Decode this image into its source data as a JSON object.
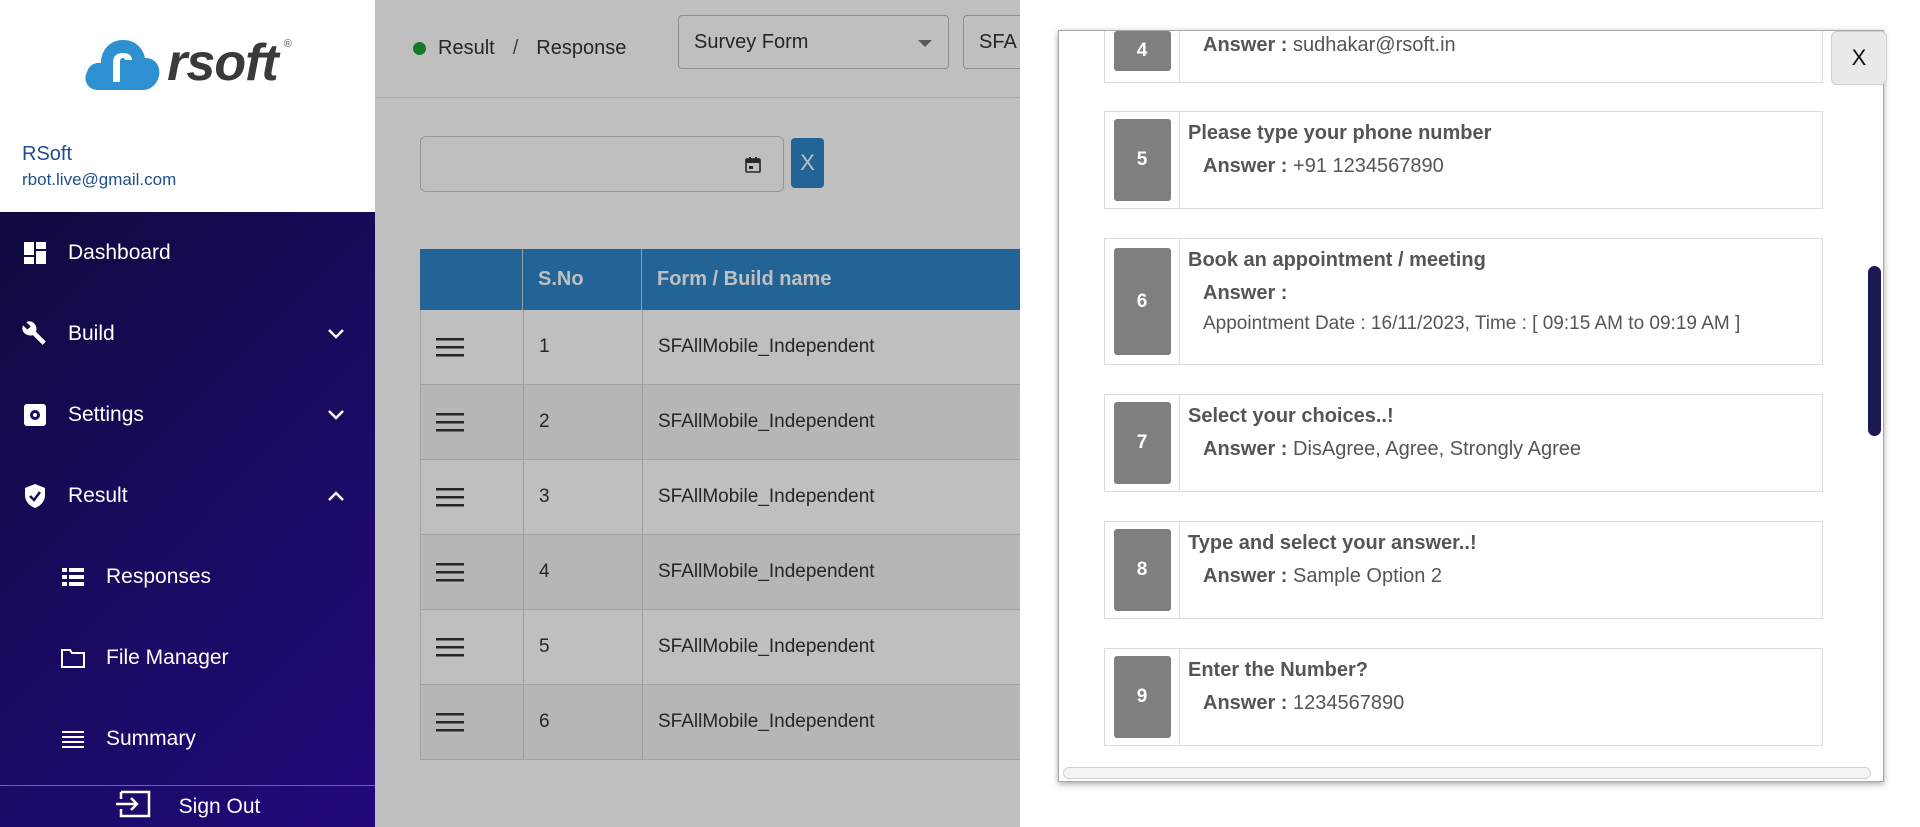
{
  "brand": {
    "name": "rsoft",
    "reg": "®"
  },
  "user": {
    "name": "RSoft",
    "email": "rbot.live@gmail.com"
  },
  "nav": {
    "dashboard": "Dashboard",
    "build": "Build",
    "settings": "Settings",
    "result": "Result",
    "responses": "Responses",
    "file_manager": "File Manager",
    "summary": "Summary",
    "sign_out": "Sign Out"
  },
  "breadcrumb": {
    "first": "Result",
    "separator": "/",
    "second": "Response"
  },
  "filters": {
    "form_type": "Survey Form",
    "form_name": "SFA"
  },
  "clear_label": "X",
  "table": {
    "headers": [
      "",
      "S.No",
      "Form / Build name"
    ],
    "rows": [
      {
        "sno": "1",
        "name": "SFAllMobile_Independent"
      },
      {
        "sno": "2",
        "name": "SFAllMobile_Independent"
      },
      {
        "sno": "3",
        "name": "SFAllMobile_Independent"
      },
      {
        "sno": "4",
        "name": "SFAllMobile_Independent"
      },
      {
        "sno": "5",
        "name": "SFAllMobile_Independent"
      },
      {
        "sno": "6",
        "name": "SFAllMobile_Independent"
      }
    ]
  },
  "answer_label": "Answer :",
  "questions": [
    {
      "num": "4",
      "question": "",
      "answer": "sudhakar@rsoft.in"
    },
    {
      "num": "5",
      "question": "Please type your phone number",
      "answer": "+91 1234567890"
    },
    {
      "num": "6",
      "question": "Book an appointment / meeting",
      "answer": "Appointment Date : 16/11/2023, Time : [ 09:15 AM to 09:19 AM ]"
    },
    {
      "num": "7",
      "question": "Select your choices..!",
      "answer": "DisAgree, Agree, Strongly Agree"
    },
    {
      "num": "8",
      "question": "Type and select your answer..!",
      "answer": "Sample Option 2"
    },
    {
      "num": "9",
      "question": "Enter the Number?",
      "answer": "1234567890"
    }
  ],
  "close_label": "X",
  "colors": {
    "nav_bg": "#1a0a63",
    "header_blue": "#2e86c8",
    "status_green": "#1ca336"
  }
}
